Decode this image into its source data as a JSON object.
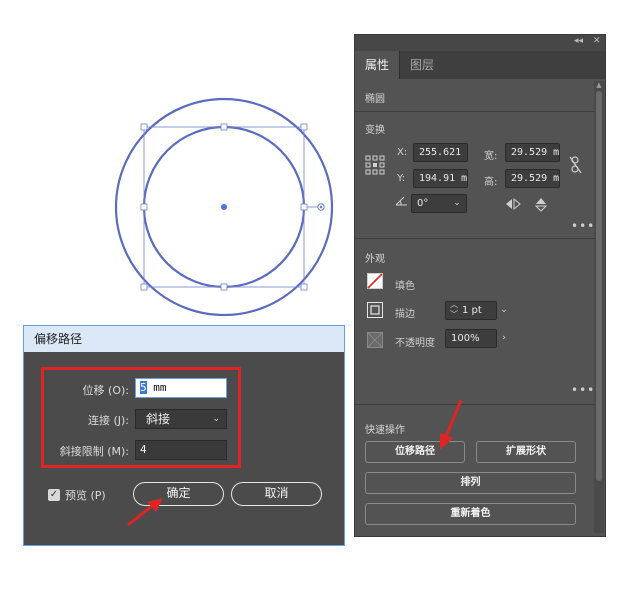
{
  "panel": {
    "tabs": [
      "属性",
      "图层"
    ],
    "object_type": "椭圆",
    "transform": {
      "title": "变换",
      "x_label": "X:",
      "x_value": "255.621",
      "y_label": "Y:",
      "y_value": "194.91 m",
      "w_label": "宽:",
      "w_value": "29.529 m",
      "h_label": "高:",
      "h_value": "29.529 m",
      "angle_value": "0°"
    },
    "appearance": {
      "title": "外观",
      "fill_label": "填色",
      "stroke_label": "描边",
      "stroke_value": "1 pt",
      "opacity_label": "不透明度",
      "opacity_value": "100%"
    },
    "quick_actions": {
      "title": "快速操作",
      "offset_path": "位移路径",
      "expand_shape": "扩展形状",
      "arrange": "排列",
      "recolor": "重新着色"
    },
    "more_glyph": "•••"
  },
  "dialog": {
    "title": "偏移路径",
    "offset_label": "位移 (O):",
    "offset_value_selected": "5",
    "offset_value_unit": " mm",
    "join_label": "连接 (J):",
    "join_value": "斜接",
    "miter_label": "斜接限制 (M):",
    "miter_value": "4",
    "preview_label": "预览 (P)",
    "preview_checked": true,
    "ok_label": "确定",
    "cancel_label": "取消"
  },
  "colors": {
    "shape_stroke": "#5b6cc0",
    "annotation_red": "#e02424",
    "panel_bg": "#535353",
    "dialog_bg": "#4b4b4b"
  }
}
